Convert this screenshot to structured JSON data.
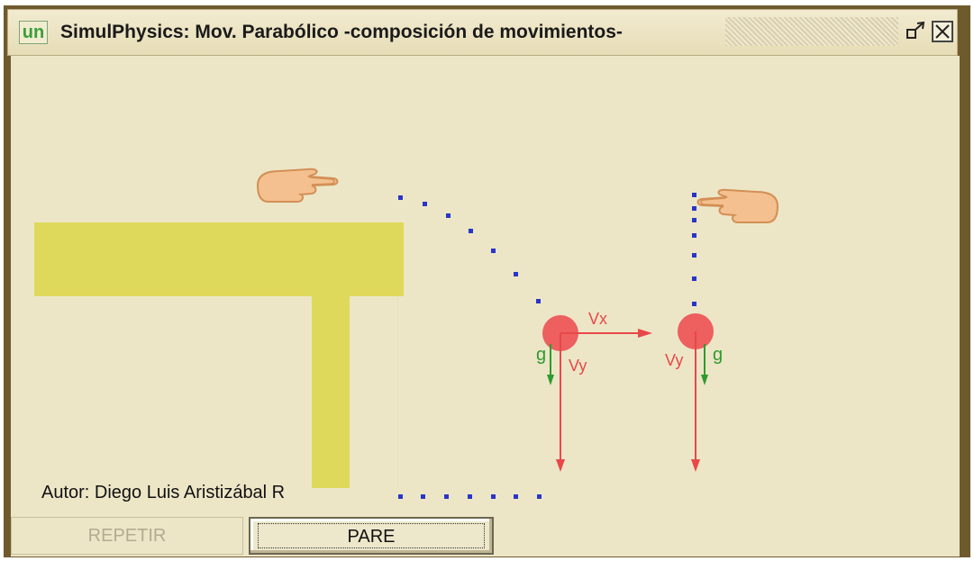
{
  "window": {
    "title": "SimulPhysics: Mov. Parabólico -composición de movimientos-",
    "logo_text": "un",
    "restore_icon": "restore-icon",
    "close_icon": "close-icon"
  },
  "simulation": {
    "labels": {
      "vx": "Vx",
      "vy_left": "Vy",
      "g_left": "g",
      "vy_right": "Vy",
      "g_right": "g"
    },
    "pointer_icons": [
      "pointing-hand-icon",
      "pointing-hand-icon"
    ],
    "colors": {
      "table": "#dfd95b",
      "ball": "#ee5f5f",
      "velocity_arrow": "#e84848",
      "gravity_arrow": "#2e9b2e",
      "trail_dots": "#2a35c8",
      "background": "#ece6c7"
    }
  },
  "author": "Autor: Diego Luis Aristizábal R",
  "buttons": {
    "repetir": "REPETIR",
    "pare": "PARE"
  }
}
